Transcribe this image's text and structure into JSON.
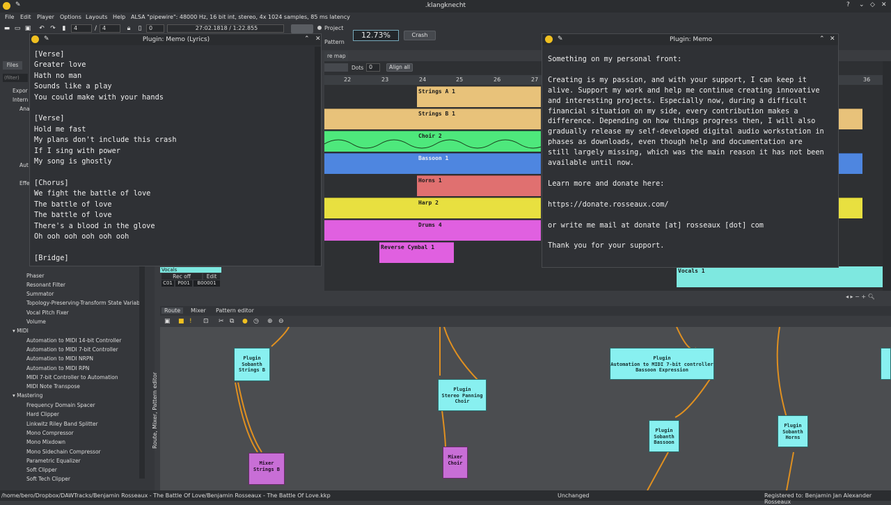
{
  "window": {
    "title": ".klangknecht"
  },
  "menu": [
    "File",
    "Edit",
    "Player",
    "Options",
    "Layouts",
    "Help"
  ],
  "audio_info": "ALSA \"pipewire\": 48000 Hz, 16 bit int, stereo, 4x 1024 samples, 85 ms latency",
  "toolbar": {
    "time_sig_num": "4",
    "time_sig_den": "4",
    "midi_ch": "0",
    "position": "27:02.1818 / 1:22.855",
    "project_label": "Project",
    "pattern_label": "Pattern",
    "cpu_load": "12.73%",
    "crash_label": "Crash"
  },
  "left_panel": {
    "files_tab": "Files",
    "filter_placeholder": "(filter)",
    "partial_items": [
      "Expor",
      "Intern",
      "Ana",
      "Aut",
      "Effe"
    ],
    "effects": [
      "Phaser",
      "Resonant Filter",
      "Summator",
      "Topology-Preserving-Transform State Variable",
      "Vocal Pitch Fixer",
      "Volume"
    ],
    "midi_label": "MIDI",
    "midi_items": [
      "Automation to MIDI 14-bit Controller",
      "Automation to MIDI 7-bit Controller",
      "Automation to MIDI NRPN",
      "Automation to MIDI RPN",
      "MIDI 7-bit Controller to Automation",
      "MIDI Note Transpose"
    ],
    "mastering_label": "Mastering",
    "mastering_items": [
      "Frequency Domain Spacer",
      "Hard Clipper",
      "Linkwitz Riley Band Splitter",
      "Mono Compressor",
      "Mono Mixdown",
      "Mono Sidechain Compressor",
      "Parametric Equalizer",
      "Soft Clipper",
      "Soft Tech Clipper"
    ]
  },
  "arrangement": {
    "tab_partial": "re map",
    "dots_label": "Dots",
    "dots_value": "0",
    "align_all": "Align all",
    "ruler": [
      "22",
      "23",
      "24",
      "25",
      "26",
      "27",
      "36"
    ],
    "clips": [
      "Strings A 1",
      "Strings B 1",
      "Choir 2",
      "Bassoon 1",
      "Horns 1",
      "Harp 2",
      "Drums 4",
      "Reverse Cymbal 1"
    ],
    "vocals_left": "Vocals",
    "vocals_right": "Vocals 1",
    "rec_off": "Rec off",
    "edit": "Edit",
    "pos_c": "C01",
    "pos_p": "P001",
    "pos_b": "B00001"
  },
  "memo_left": {
    "title": "Plugin: Memo (Lyrics)",
    "lines": [
      "[Verse]",
      "Greater love",
      "Hath no man",
      "Sounds like a play",
      "You could make with your hands",
      "",
      "[Verse]",
      "Hold me fast",
      "My plans don't include this crash",
      "If I sing with power",
      "My song is ghostly",
      "",
      "[Chorus]",
      "We fight the battle of love",
      "The battle of love",
      "The battle of love",
      "There's a blood in the glove",
      "Oh ooh ooh ooh ooh ooh",
      "",
      "[Bridge]"
    ]
  },
  "memo_right": {
    "title": "Plugin: Memo",
    "lines": [
      "Something on my personal front:",
      "",
      "Creating is my passion, and with your support, I can keep it",
      "alive. Support my work and help me continue creating innovative",
      "and interesting projects. Especially now, during a difficult",
      "financial situation on my side, every contribution makes a",
      "difference. Depending on how things progress then, I will also",
      "gradually release my self-developed digital audio workstation in",
      "phases as downloads, even though help and documentation are",
      "still largely missing, which was the main reason it has not been",
      "available until now.",
      "",
      "Learn more and donate here:",
      "",
      "https://donate.rosseaux.com/",
      "",
      "or write me mail at donate [at] rosseaux [dot] com",
      "",
      "Thank you for your support."
    ]
  },
  "bottom_tabs": [
    "Route",
    "Mixer",
    "Pattern editor"
  ],
  "vertical_tab": "Route, Mixer, Pattern editor",
  "nodes": [
    {
      "kind": "plugin",
      "text": [
        "Plugin",
        "Sobanth",
        "Strings B"
      ]
    },
    {
      "kind": "plugin",
      "text": [
        "Plugin",
        "Stereo Panning",
        "Choir"
      ]
    },
    {
      "kind": "plugin",
      "text": [
        "Plugin",
        "Automation to MIDI 7-bit controller",
        "Bassoon Expression"
      ]
    },
    {
      "kind": "plugin",
      "text": [
        "Plugin",
        "Sobanth",
        "Bassoon"
      ]
    },
    {
      "kind": "plugin",
      "text": [
        "Plugin",
        "Sobanth",
        "Horns"
      ]
    },
    {
      "kind": "mixer",
      "text": [
        "Mixer",
        "Strings B"
      ]
    },
    {
      "kind": "mixer",
      "text": [
        "Mixer",
        "Choir"
      ]
    }
  ],
  "statusbar": {
    "path": "/home/bero/Dropbox/DAWTracks/Benjamin Rosseaux - The Battle Of Love/Benjamin Rosseaux - The Battle Of Love.kkp",
    "state": "Unchanged",
    "registered": "Registered to: Benjamin Jan Alexander Rosseaux"
  },
  "colors": {
    "strings": "#e8c27a",
    "choir": "#4ee87c",
    "bassoon": "#4e86e0",
    "horns": "#e07070",
    "harp": "#e8e040",
    "drums": "#e060e0",
    "vocals": "#7ee8e0",
    "node": "#88f0f0",
    "mixer": "#c86ed6"
  }
}
